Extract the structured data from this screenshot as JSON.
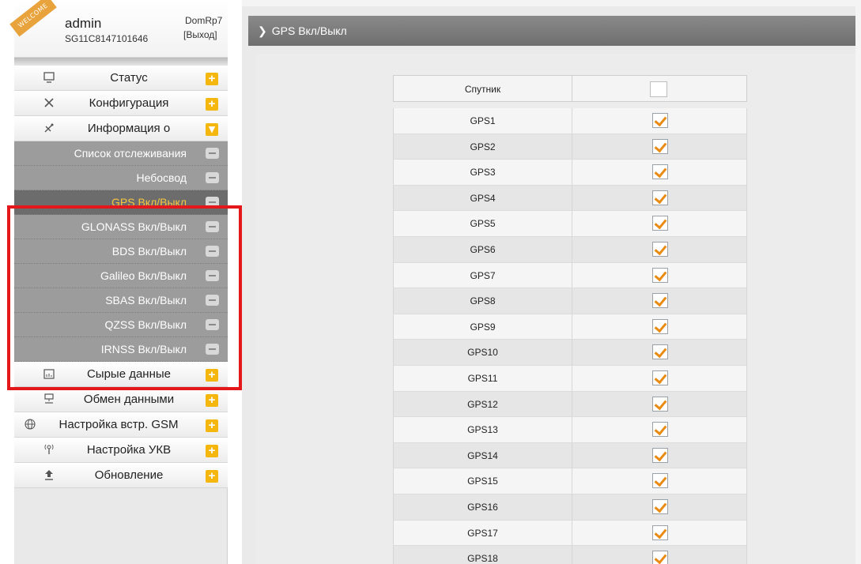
{
  "user": {
    "badge": "WELCOME",
    "name": "admin",
    "serial": "SG11C8147101646",
    "host": "DomRp7",
    "exit": "[Выход]"
  },
  "menu": {
    "status": "Статус",
    "config": "Конфигурация",
    "info": "Информация о",
    "raw": "Сырые данные",
    "exchange": "Обмен данными",
    "gsm": "Настройка встр. GSM",
    "ukv": "Настройка УКВ",
    "update": "Обновление"
  },
  "submenu": {
    "tracking": "Список отслеживания",
    "sky": "Небосвод",
    "gps": "GPS Вкл/Выкл",
    "glonass": "GLONASS Вкл/Выкл",
    "bds": "BDS Вкл/Выкл",
    "galileo": "Galileo Вкл/Выкл",
    "sbas": "SBAS Вкл/Выкл",
    "qzss": "QZSS Вкл/Выкл",
    "irnss": "IRNSS Вкл/Выкл"
  },
  "icons": {
    "status": "monitor-icon",
    "config": "wrench-icon",
    "info": "satellite-icon",
    "raw": "calendar-icon",
    "exchange": "network-icon",
    "gsm": "globe-icon",
    "ukv": "antenna-icon",
    "update": "upload-icon",
    "plus": "+",
    "down": "▾"
  },
  "breadcrumb": {
    "arrow": "❯",
    "title": "GPS Вкл/Выкл"
  },
  "table": {
    "header": "Спутник",
    "rows": [
      "GPS1",
      "GPS2",
      "GPS3",
      "GPS4",
      "GPS5",
      "GPS6",
      "GPS7",
      "GPS8",
      "GPS9",
      "GPS10",
      "GPS11",
      "GPS12",
      "GPS13",
      "GPS14",
      "GPS15",
      "GPS16",
      "GPS17",
      "GPS18"
    ]
  },
  "colors": {
    "accent": "#f5b70e",
    "highlight": "#e4171b",
    "checkmark": "#e98a12",
    "active_label": "#f5c542"
  }
}
